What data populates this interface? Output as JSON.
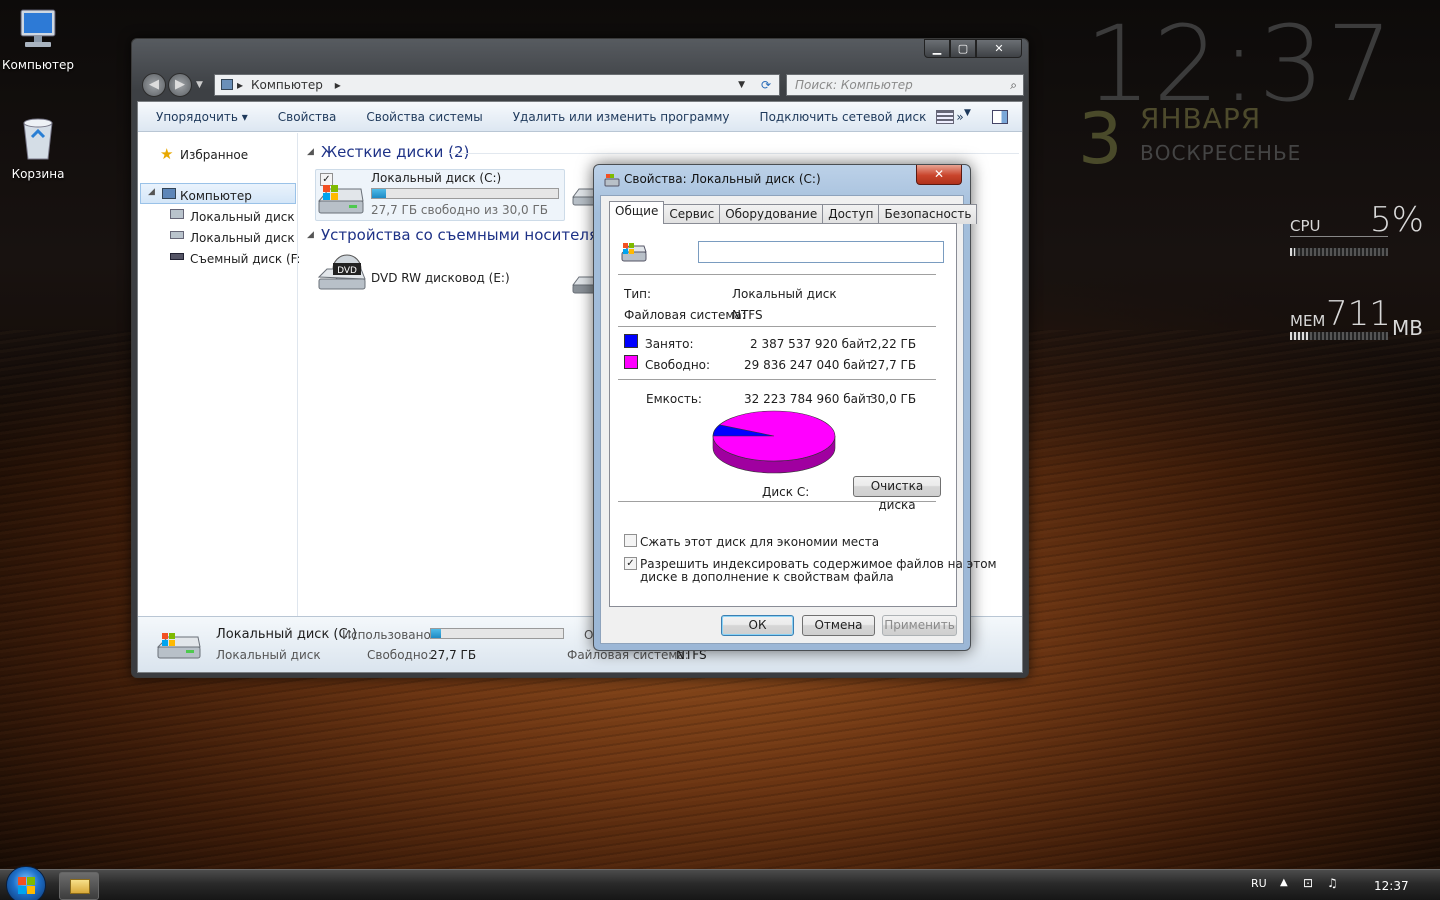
{
  "desktop": {
    "icons": [
      {
        "label": "Компьютер"
      },
      {
        "label": "Корзина"
      }
    ]
  },
  "gadgets": {
    "time": "12:37",
    "day": "3",
    "month": "ЯНВАРЯ",
    "weekday": "ВОСКРЕСЕНЬЕ",
    "cpu_label": "CPU",
    "cpu_value": "5%",
    "cpu_fraction": 0.05,
    "mem_label": "MEM",
    "mem_value": "711",
    "mem_unit": "MB",
    "mem_fraction": 0.18
  },
  "explorer": {
    "address": "Компьютер",
    "search_placeholder": "Поиск: Компьютер",
    "toolbar": [
      "Упорядочить",
      "Свойства",
      "Свойства системы",
      "Удалить или изменить программу",
      "Подключить сетевой диск",
      "»"
    ],
    "sidebar": {
      "favorites": "Избранное",
      "computer": "Компьютер",
      "items": [
        "Локальный диск (C",
        "Локальный диск (D",
        "Съемный диск (F:)"
      ]
    },
    "groups": {
      "hdd": "Жесткие диски (2)",
      "removable": "Устройства со съемными носителями ("
    },
    "drive_c": {
      "name": "Локальный диск (C:)",
      "free": "27,7 ГБ свободно из 30,0 ГБ",
      "used_fraction": 0.074
    },
    "dvd": {
      "name": "DVD RW дисковод (E:)",
      "badge": "DVD"
    },
    "details": {
      "name": "Локальный диск (C:)",
      "type": "Локальный диск",
      "used_label": "Использовано:",
      "free_label": "Свободно:",
      "free_value": "27,7 ГБ",
      "fs_label": "Файловая система:",
      "fs_value": "NTFS",
      "cut": "О"
    }
  },
  "dialog": {
    "title": "Свойства: Локальный диск (C:)",
    "tabs": [
      "Общие",
      "Сервис",
      "Оборудование",
      "Доступ",
      "Безопасность"
    ],
    "name_value": "",
    "type_label": "Тип:",
    "type_value": "Локальный диск",
    "fs_label": "Файловая система:",
    "fs_value": "NTFS",
    "used_label": "Занято:",
    "used_bytes": "2 387 537 920 байт",
    "used_gb": "2,22 ГБ",
    "used_color": "#0000ff",
    "free_label": "Свободно:",
    "free_bytes": "29 836 247 040 байт",
    "free_gb": "27,7 ГБ",
    "free_color": "#ff00ff",
    "capacity_label": "Емкость:",
    "capacity_bytes": "32 223 784 960 байт",
    "capacity_gb": "30,0 ГБ",
    "disk_label": "Диск C:",
    "cleanup": "Очистка диска",
    "compress": "Сжать этот диск для экономии места",
    "compress_checked": false,
    "index_line1": "Разрешить индексировать содержимое файлов на этом",
    "index_line2": "диске в дополнение к свойствам файла",
    "index_checked": true,
    "ok": "ОК",
    "cancel": "Отмена",
    "apply": "Применить"
  },
  "taskbar": {
    "lang": "RU",
    "time": "12:37"
  }
}
